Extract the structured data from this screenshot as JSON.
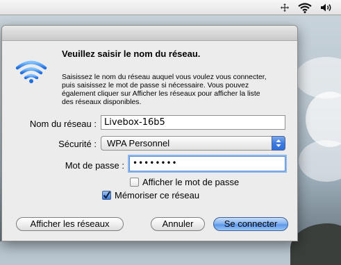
{
  "menubar": {
    "icons": [
      "move-icon",
      "wifi-icon",
      "volume-icon"
    ]
  },
  "dialog": {
    "title": "Veuillez saisir le nom du réseau.",
    "description": "Saisissez le nom du réseau auquel vous voulez vous connecter, puis saisissez le mot de passe si nécessaire. Vous pouvez également cliquer sur Afficher les réseaux pour afficher la liste des réseaux disponibles.",
    "icon": "wifi-icon",
    "fields": {
      "network_name_label": "Nom du réseau :",
      "network_name_value": "Livebox-16b5",
      "security_label": "Sécurité :",
      "security_value": "WPA Personnel",
      "password_label": "Mot de passe :",
      "password_value": "••••••••"
    },
    "checkboxes": {
      "show_password": {
        "label": "Afficher le mot de passe",
        "checked": false
      },
      "remember_network": {
        "label": "Mémoriser ce réseau",
        "checked": true
      }
    },
    "buttons": {
      "show_networks": "Afficher les réseaux",
      "cancel": "Annuler",
      "connect": "Se connecter"
    }
  },
  "colors": {
    "accent": "#5d97e8",
    "focus_ring": "#8fb8ee"
  }
}
